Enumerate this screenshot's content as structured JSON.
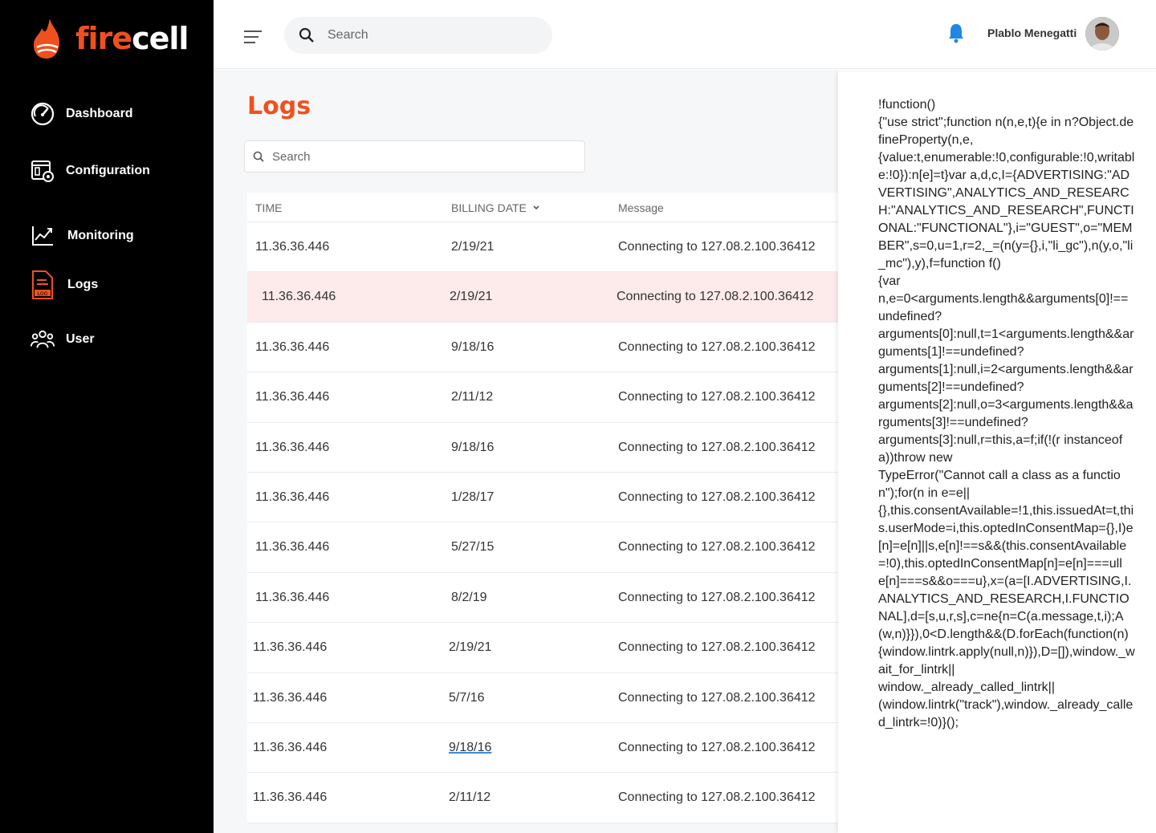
{
  "brand": {
    "part1": "fire",
    "part2": "cell"
  },
  "colors": {
    "accent": "#f0501e",
    "sidebar": "#000000",
    "bell": "#1e88e5",
    "highlight_row": "#fdeaea"
  },
  "sidebar": {
    "items": [
      {
        "label": "Dashboard",
        "icon": "speedometer-icon"
      },
      {
        "label": "Configuration",
        "icon": "config-gear-icon"
      },
      {
        "label": "Monitoring",
        "icon": "chart-line-icon"
      },
      {
        "label": "Logs",
        "icon": "log-file-icon"
      },
      {
        "label": "User",
        "icon": "users-icon"
      }
    ]
  },
  "topbar": {
    "search_placeholder": "Search",
    "user_name": "Plablo Menegatti"
  },
  "main": {
    "title": "Logs",
    "search_placeholder": "Search",
    "columns": {
      "time": "TIME",
      "billing_date": "BILLING DATE",
      "message": "Message"
    },
    "rows": [
      {
        "time": "11.36.36.446",
        "date": "2/19/21",
        "message": "Connecting to 127.08.2.100.36412"
      },
      {
        "time": "11.36.36.446",
        "date": "2/19/21",
        "message": "Connecting to 127.08.2.100.36412"
      },
      {
        "time": "11.36.36.446",
        "date": "9/18/16",
        "message": "Connecting to 127.08.2.100.36412"
      },
      {
        "time": "11.36.36.446",
        "date": "2/11/12",
        "message": "Connecting to 127.08.2.100.36412"
      },
      {
        "time": "11.36.36.446",
        "date": "9/18/16",
        "message": "Connecting to 127.08.2.100.36412"
      },
      {
        "time": "11.36.36.446",
        "date": "1/28/17",
        "message": "Connecting to 127.08.2.100.36412"
      },
      {
        "time": "11.36.36.446",
        "date": "5/27/15",
        "message": "Connecting to 127.08.2.100.36412"
      },
      {
        "time": "11.36.36.446",
        "date": "8/2/19",
        "message": "Connecting to 127.08.2.100.36412"
      },
      {
        "time": "11.36.36.446",
        "date": "2/19/21",
        "message": "Connecting to 127.08.2.100.36412"
      },
      {
        "time": "11.36.36.446",
        "date": "5/7/16",
        "message": "Connecting to 127.08.2.100.36412"
      },
      {
        "time": "11.36.36.446",
        "date": "9/18/16",
        "message": "Connecting to 127.08.2.100.36412"
      },
      {
        "time": "11.36.36.446",
        "date": "2/11/12",
        "message": "Connecting to 127.08.2.100.36412"
      }
    ]
  },
  "code_panel": {
    "text": "!function()\n{\"use strict\";function n(n,e,t){e in n?Object.defineProperty(n,e,\n{value:t,enumerable:!0,configurable:!0,writable:!0}):n[e]=t}var a,d,c,I={ADVERTISING:\"ADVERTISING\",ANALYTICS_AND_RESEARCH:\"ANALYTICS_AND_RESEARCH\",FUNCTIONAL:\"FUNCTIONAL\"},i=\"GUEST\",o=\"MEMBER\",s=0,u=1,r=2,_=(n(y={},i,\"li_gc\"),n(y,o,\"li_mc\"),y),f=function f()\n{var\nn,e=0<arguments.length&&arguments[0]!==undefined?\narguments[0]:null,t=1<arguments.length&&arguments[1]!==undefined?\narguments[1]:null,i=2<arguments.length&&arguments[2]!==undefined?\narguments[2]:null,o=3<arguments.length&&arguments[3]!==undefined?\narguments[3]:null,r=this,a=f;if(!(r instanceof a))throw new\nTypeError(\"Cannot call a class as a function\");for(n in e=e||\n{},this.consentAvailable=!1,this.issuedAt=t,this.userMode=i,this.optedInConsentMap={},I)e[n]=e[n]||s,e[n]!==s&&(this.consentAvailable=!0),this.optedInConsentMap[n]=e[n]===ull\ne[n]===s&&o===u},x=(a=[I.ADVERTISING,I.ANALYTICS_AND_RESEARCH,I.FUNCTIONAL],d=[s,u,r,s],c=ne{n=C(a.message,t,i);A(w,n)}}),0<D.length&&(D.forEach(function(n)\n{window.lintrk.apply(null,n)}),D=[]),window._wait_for_lintrk||\nwindow._already_called_lintrk||\n(window.lintrk(\"track\"),window._already_called_lintrk=!0)}();"
  }
}
